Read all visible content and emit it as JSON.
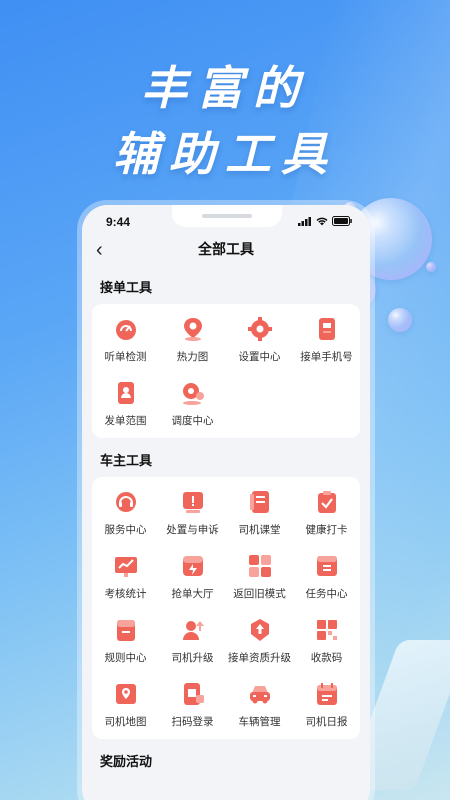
{
  "headline": {
    "line1": "丰富的",
    "line2": "辅助工具"
  },
  "status_bar": {
    "time": "9:44"
  },
  "nav": {
    "title": "全部工具"
  },
  "sections": [
    {
      "title": "接单工具",
      "items": [
        {
          "label": "听单检测",
          "icon": "gauge-icon"
        },
        {
          "label": "热力图",
          "icon": "map-pin-icon"
        },
        {
          "label": "设置中心",
          "icon": "settings-gear-icon"
        },
        {
          "label": "接单手机号",
          "icon": "phone-card-icon"
        },
        {
          "label": "发单范围",
          "icon": "document-user-icon"
        },
        {
          "label": "调度中心",
          "icon": "dispatch-location-icon"
        }
      ]
    },
    {
      "title": "车主工具",
      "items": [
        {
          "label": "服务中心",
          "icon": "headset-icon"
        },
        {
          "label": "处置与申诉",
          "icon": "alert-board-icon"
        },
        {
          "label": "司机课堂",
          "icon": "notebook-icon"
        },
        {
          "label": "健康打卡",
          "icon": "clipboard-check-icon"
        },
        {
          "label": "考核统计",
          "icon": "chart-board-icon"
        },
        {
          "label": "抢单大厅",
          "icon": "grab-order-icon"
        },
        {
          "label": "返回旧模式",
          "icon": "grid-mode-icon"
        },
        {
          "label": "任务中心",
          "icon": "task-box-icon"
        },
        {
          "label": "规则中心",
          "icon": "rule-book-icon"
        },
        {
          "label": "司机升级",
          "icon": "user-upgrade-icon"
        },
        {
          "label": "接单资质升级",
          "icon": "badge-upgrade-icon"
        },
        {
          "label": "收款码",
          "icon": "qr-code-icon"
        },
        {
          "label": "司机地图",
          "icon": "driver-map-icon"
        },
        {
          "label": "扫码登录",
          "icon": "scan-login-icon"
        },
        {
          "label": "车辆管理",
          "icon": "car-icon"
        },
        {
          "label": "司机日报",
          "icon": "calendar-day-icon"
        }
      ]
    },
    {
      "title": "奖励活动",
      "items": []
    }
  ],
  "colors": {
    "accent": "#f0655a",
    "accent_light": "#f7a29a",
    "text": "#333333"
  }
}
